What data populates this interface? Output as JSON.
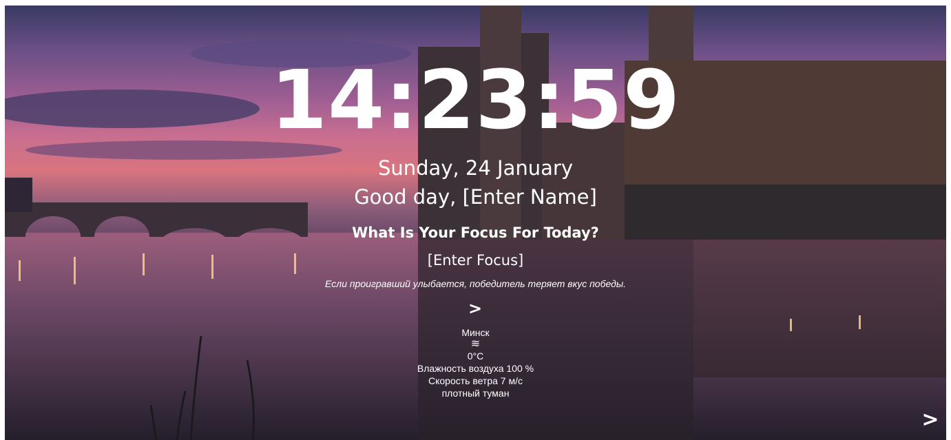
{
  "clock": {
    "time": "14:23:59"
  },
  "date": {
    "text": "Sunday, 24 January"
  },
  "greeting": {
    "prefix": "Good day, ",
    "name": "[Enter Name]"
  },
  "focus": {
    "question": "What Is Your Focus For Today?",
    "value": "[Enter Focus]"
  },
  "quote": {
    "text": "Если проигравший улыбается, победитель теряет вкус победы.",
    "next_label": ">"
  },
  "weather": {
    "city": "Минск",
    "icon_glyph": "≋",
    "icon": "fog-icon",
    "temperature": "0°C",
    "humidity": "Влажность воздуха 100 %",
    "wind": "Скорость ветра 7 м/с",
    "description": "плотный туман"
  },
  "background": {
    "next_label": ">"
  },
  "colors": {
    "text": "#ffffff",
    "sky_top": "#3a3a63",
    "sky_glow": "#d9747f",
    "water": "#2b2636"
  }
}
